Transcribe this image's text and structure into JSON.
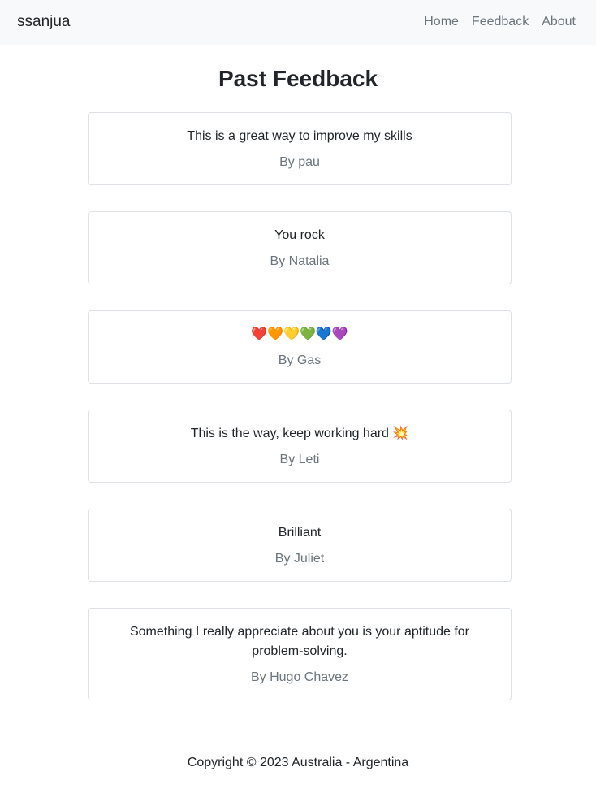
{
  "navbar": {
    "brand": "ssanjua",
    "links": [
      "Home",
      "Feedback",
      "About"
    ]
  },
  "page": {
    "title": "Past Feedback"
  },
  "feedback": [
    {
      "text": "This is a great way to improve my skills",
      "author": "By pau"
    },
    {
      "text": "You rock",
      "author": "By Natalia"
    },
    {
      "text": "❤️🧡💛💚💙💜",
      "author": "By Gas"
    },
    {
      "text": "This is the way, keep working hard 💥",
      "author": "By Leti"
    },
    {
      "text": "Brilliant",
      "author": "By Juliet"
    },
    {
      "text": "Something I really appreciate about you is your aptitude for problem-solving.",
      "author": "By Hugo Chavez"
    }
  ],
  "footer": {
    "copyright": "Copyright © 2023 Australia - Argentina"
  }
}
